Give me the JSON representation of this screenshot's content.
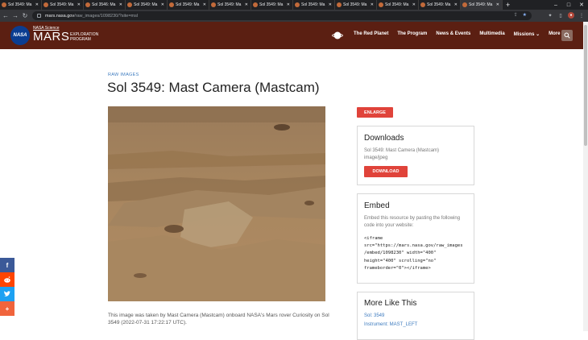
{
  "browser": {
    "tabs": [
      {
        "label": "Sol 3549: Ma"
      },
      {
        "label": "Sol 3549: Ma"
      },
      {
        "label": "Sol 3546: Ma"
      },
      {
        "label": "Sol 3549: Ma"
      },
      {
        "label": "Sol 3549: Ma"
      },
      {
        "label": "Sol 3549: Ma"
      },
      {
        "label": "Sol 3549: Ma"
      },
      {
        "label": "Sol 3549: Ma"
      },
      {
        "label": "Sol 3549: Ma"
      },
      {
        "label": "Sol 3549: Ma"
      },
      {
        "label": "Sol 3549: Ma"
      },
      {
        "label": "Sol 3549: Ma"
      }
    ],
    "url_host": "mars.nasa.gov",
    "url_path": "/raw_images/1098230/?site=msl"
  },
  "header": {
    "nasa_logo_text": "NASA",
    "sup_text": "NASA Science",
    "brand_title": "MARS",
    "brand_subtitle": "EXPLORATION PROGRAM",
    "nav": [
      "The Red Planet",
      "The Program",
      "News & Events",
      "Multimedia",
      "Missions",
      "More"
    ]
  },
  "main": {
    "eyebrow": "RAW IMAGES",
    "title": "Sol 3549: Mast Camera (Mastcam)",
    "caption": "This image was taken by Mast Camera (Mastcam) onboard NASA's Mars rover Curiosity on Sol 3549 (2022-07-31 17:22:17 UTC)."
  },
  "sidebar": {
    "enlarge_label": "ENLARGE",
    "downloads": {
      "heading": "Downloads",
      "line1": "Sol 3549: Mast Camera (Mastcam)",
      "line2": "image/jpeg",
      "button": "DOWNLOAD"
    },
    "embed": {
      "heading": "Embed",
      "description": "Embed this resource by pasting the following code into your website:",
      "code": "<iframe\nsrc=\"https://mars.nasa.gov/raw_images\n/embed/1098230\" width=\"400\"\nheight=\"400\" scrolling=\"no\"\nframeborder=\"0\"></iframe>"
    },
    "more_like_this": {
      "heading": "More Like This",
      "links": [
        "Sol: 3549",
        "Instrument: MAST_LEFT"
      ]
    }
  },
  "share": [
    "f",
    "reddit",
    "twitter",
    "+"
  ]
}
